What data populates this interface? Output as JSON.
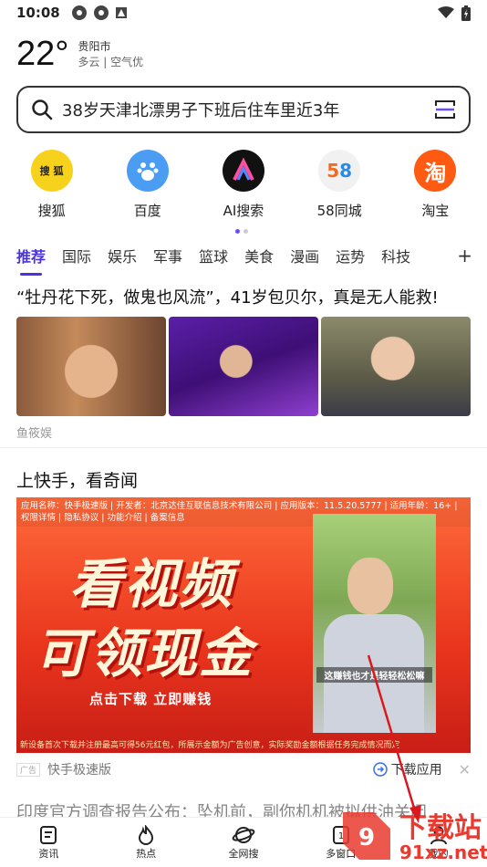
{
  "status_bar": {
    "time": "10:08"
  },
  "weather": {
    "temperature": "22°",
    "city": "贵阳市",
    "condition": "多云 | 空气优"
  },
  "search": {
    "query": "38岁天津北漂男子下班后住车里近3年"
  },
  "shortcuts": [
    {
      "label": "搜狐",
      "icon": "sohu-logo"
    },
    {
      "label": "百度",
      "icon": "baidu-logo"
    },
    {
      "label": "AI搜索",
      "icon": "ai-search-logo"
    },
    {
      "label": "58同城",
      "icon": "58-logo"
    },
    {
      "label": "淘宝",
      "icon": "taobao-logo"
    }
  ],
  "tabs": [
    "推荐",
    "国际",
    "娱乐",
    "军事",
    "篮球",
    "美食",
    "漫画",
    "运势",
    "科技"
  ],
  "tabs_plus": "+",
  "news1": {
    "headline": "“牡丹花下死，做鬼也风流”，41岁包贝尔，真是无人能救!",
    "source": "鱼筱娱"
  },
  "ad": {
    "title": "上快手，看奇闻",
    "meta": "应用名称：快手极速版 | 开发者：北京达佳互联信息技术有限公司 | 应用版本：11.5.20.5777 | 适用年龄：16+ | 权限详情 | 隐私协议 | 功能介绍 | 备案信息",
    "big_line1": "看视频",
    "big_line2": "可领现金",
    "cta": "点击下载 立即赚钱",
    "photo_caption": "这赚钱也才是轻轻松松嘛",
    "footer": "新设备首次下载并注册最高可得56元红包，所展示金额为广告创意，实际奖励金额根据任务完成情况而定",
    "ad_tag": "广告",
    "app_name": "快手极速版",
    "download_label": "下载应用",
    "close": "✕"
  },
  "next_headline_peek": "印度官方调查报告公布：坠机前，副你机机被拟供油关闭",
  "bottom_nav": [
    {
      "label": "资讯",
      "icon": "news-icon"
    },
    {
      "label": "热点",
      "icon": "flame-icon"
    },
    {
      "label": "全网搜",
      "icon": "planet-icon"
    },
    {
      "label": "多窗口",
      "icon": "window-icon"
    },
    {
      "label": "我的",
      "icon": "user-icon"
    }
  ],
  "watermark": {
    "text1": "下载站",
    "text2": "91xz.net"
  },
  "colors": {
    "accent": "#4a32e0",
    "ad_red": "#e8341c",
    "watermark_red": "#e93a30"
  }
}
